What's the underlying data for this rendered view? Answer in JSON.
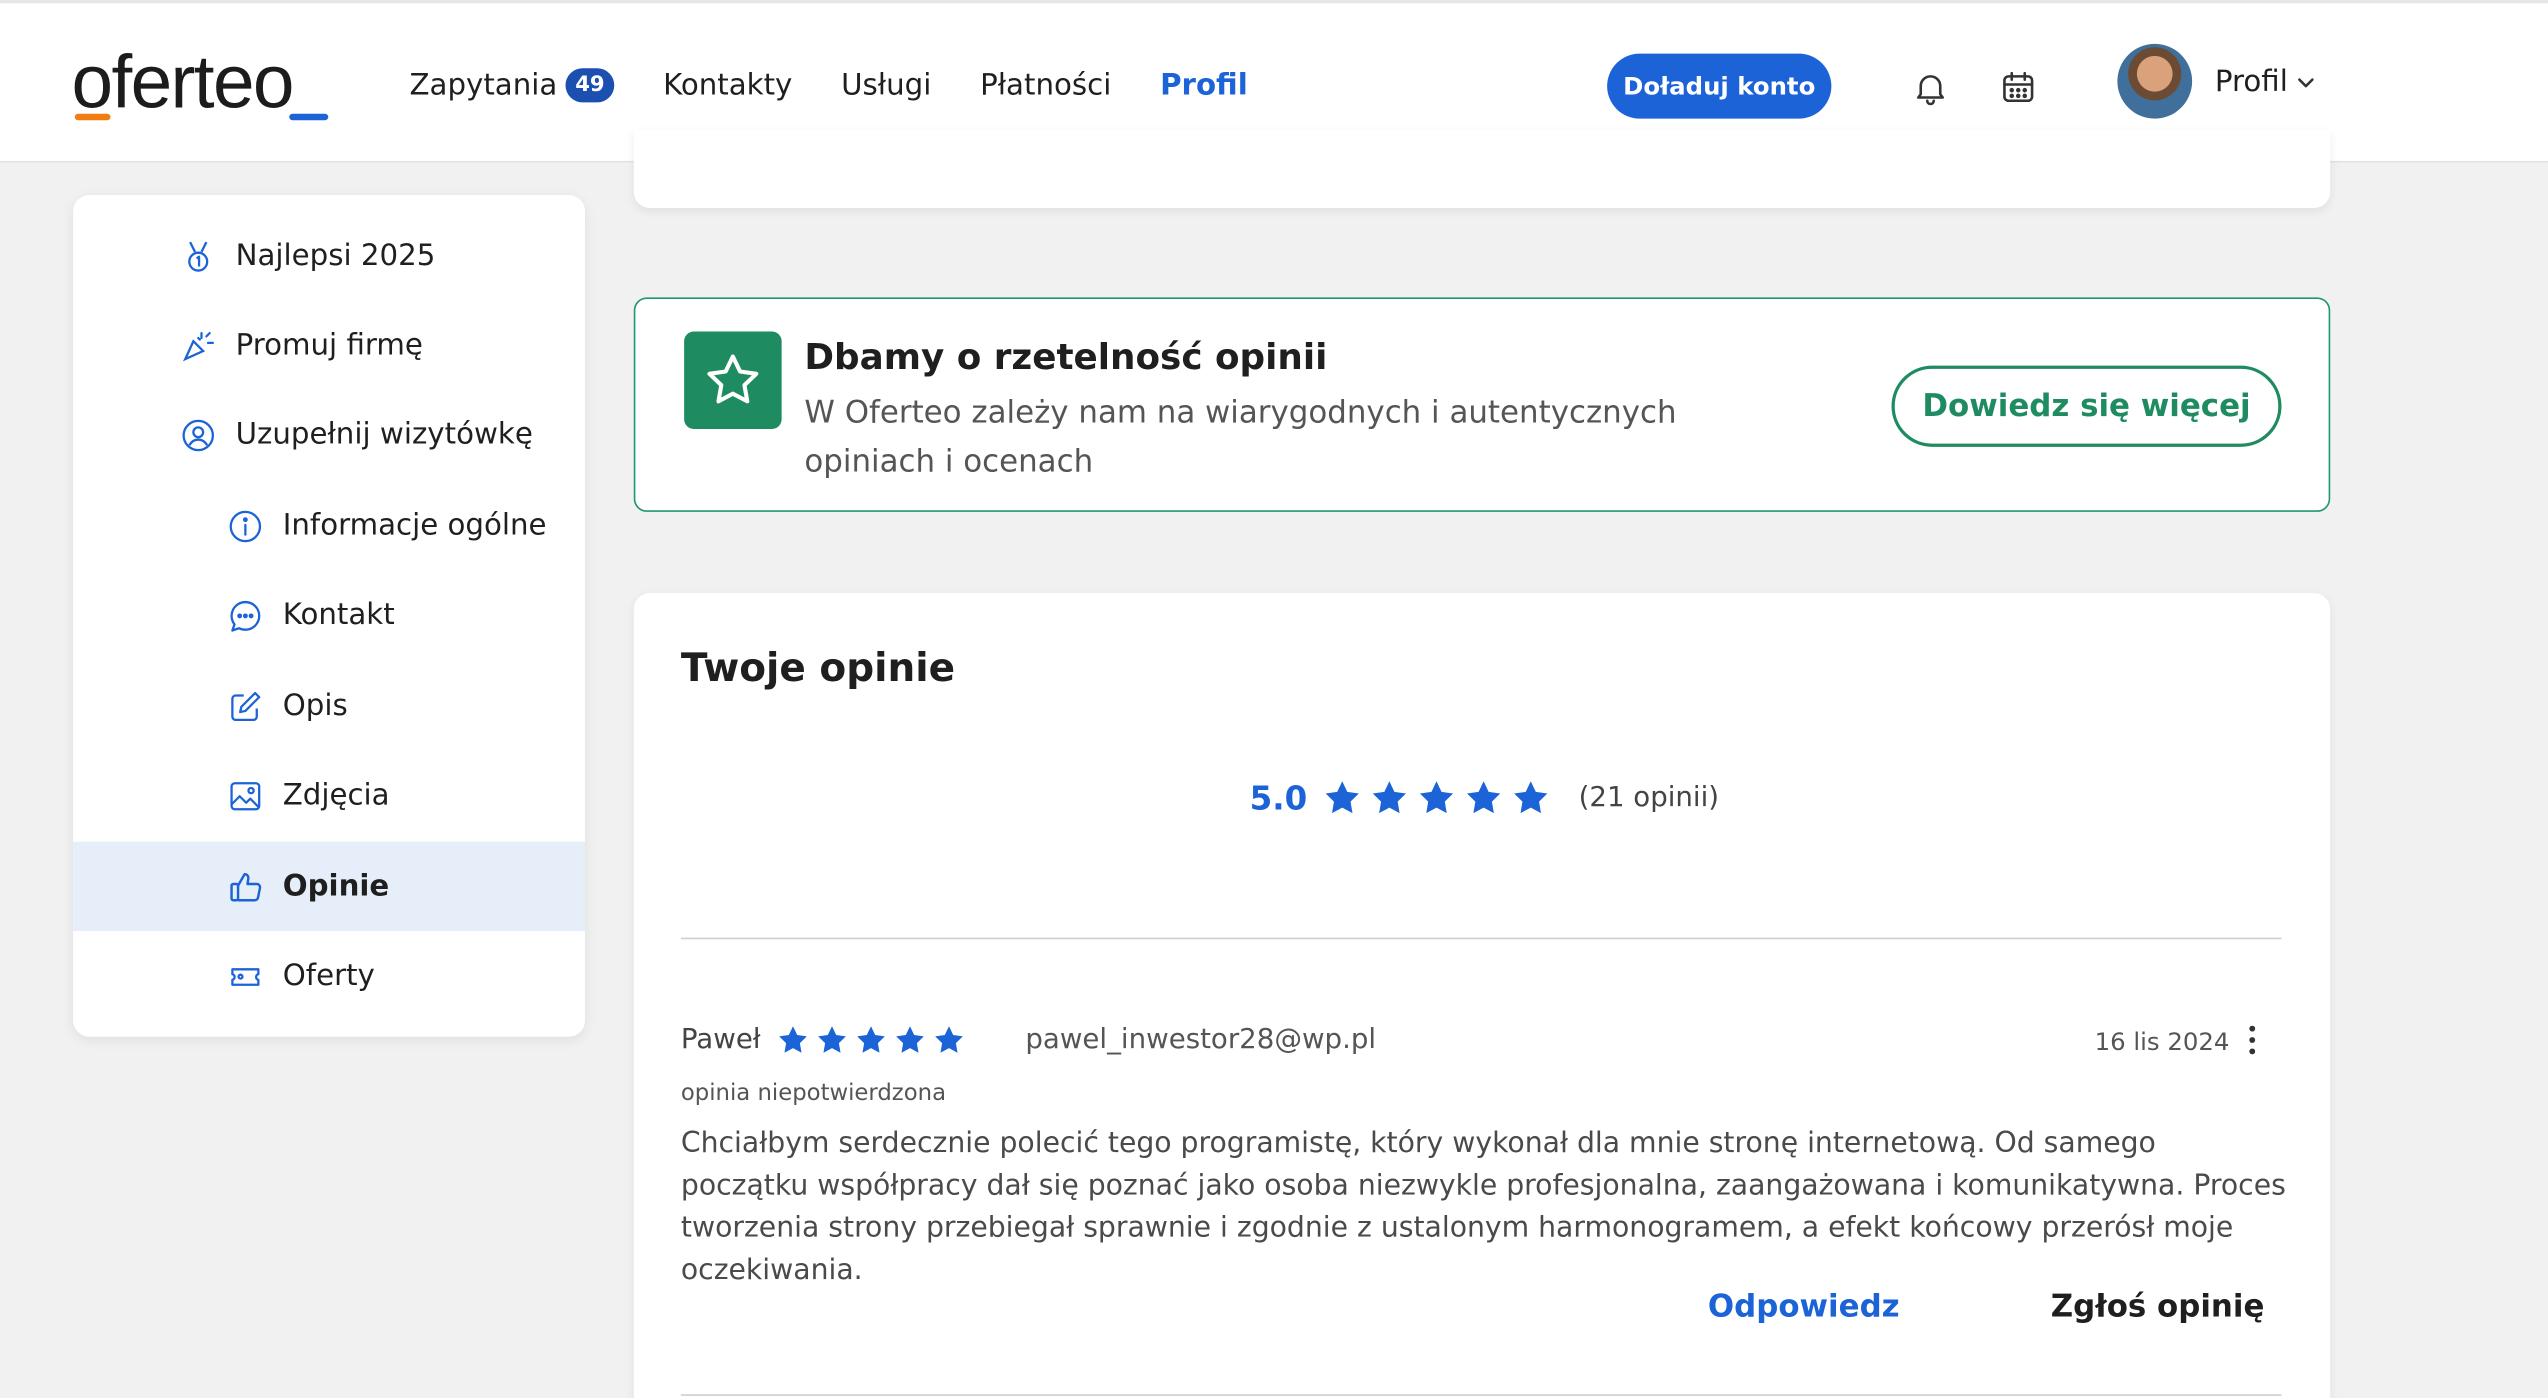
{
  "header": {
    "logo": "oferteo",
    "nav": [
      {
        "label": "Zapytania",
        "badge": "49"
      },
      {
        "label": "Kontakty"
      },
      {
        "label": "Usługi"
      },
      {
        "label": "Płatności"
      },
      {
        "label": "Profil",
        "active": true
      }
    ],
    "topup_label": "Doładuj konto",
    "profile_label": "Profil",
    "icons": [
      "bell-icon",
      "calendar-icon",
      "chevron-down-icon"
    ]
  },
  "sidebar": {
    "items": [
      {
        "label": "Najlepsi 2025",
        "icon": "medal-icon"
      },
      {
        "label": "Promuj firmę",
        "icon": "sparkles-icon"
      },
      {
        "label": "Uzupełnij wizytówkę",
        "icon": "user-circle-icon"
      },
      {
        "label": "Informacje ogólne",
        "icon": "info-icon"
      },
      {
        "label": "Kontakt",
        "icon": "chat-icon"
      },
      {
        "label": "Opis",
        "icon": "edit-icon"
      },
      {
        "label": "Zdjęcia",
        "icon": "image-icon"
      },
      {
        "label": "Opinie",
        "icon": "thumbs-up-icon",
        "active": true
      },
      {
        "label": "Oferty",
        "icon": "ticket-icon"
      }
    ]
  },
  "trust": {
    "title": "Dbamy o rzetelność opinii",
    "text": "W Oferteo zależy nam na wiarygodnych i autentycznych opiniach i ocenach",
    "button": "Dowiedz się więcej",
    "icon": "star-outline-icon"
  },
  "reviews": {
    "title": "Twoje opinie",
    "score": "5.0",
    "rating": 5,
    "count_label": "(21 opinii)",
    "items": [
      {
        "author": "Paweł",
        "rating": 5,
        "email": "pawel_inwestor28@wp.pl",
        "date": "16 lis 2024",
        "status": "opinia niepotwierdzona",
        "body": "Chciałbym serdecznie polecić tego programistę, który wykonał dla mnie stronę internetową. Od samego początku współpracy dał się poznać jako osoba niezwykle profesjonalna, zaangażowana i komunikatywna. Proces tworzenia strony przebiegał sprawnie i zgodnie z ustalonym harmonogramem, a efekt końcowy przerósł moje oczekiwania.",
        "reply_label": "Odpowiedz",
        "report_label": "Zgłoś opinię"
      }
    ]
  },
  "colors": {
    "primary": "#1b63d6",
    "green": "#1e8b60",
    "orange": "#f07c12"
  }
}
